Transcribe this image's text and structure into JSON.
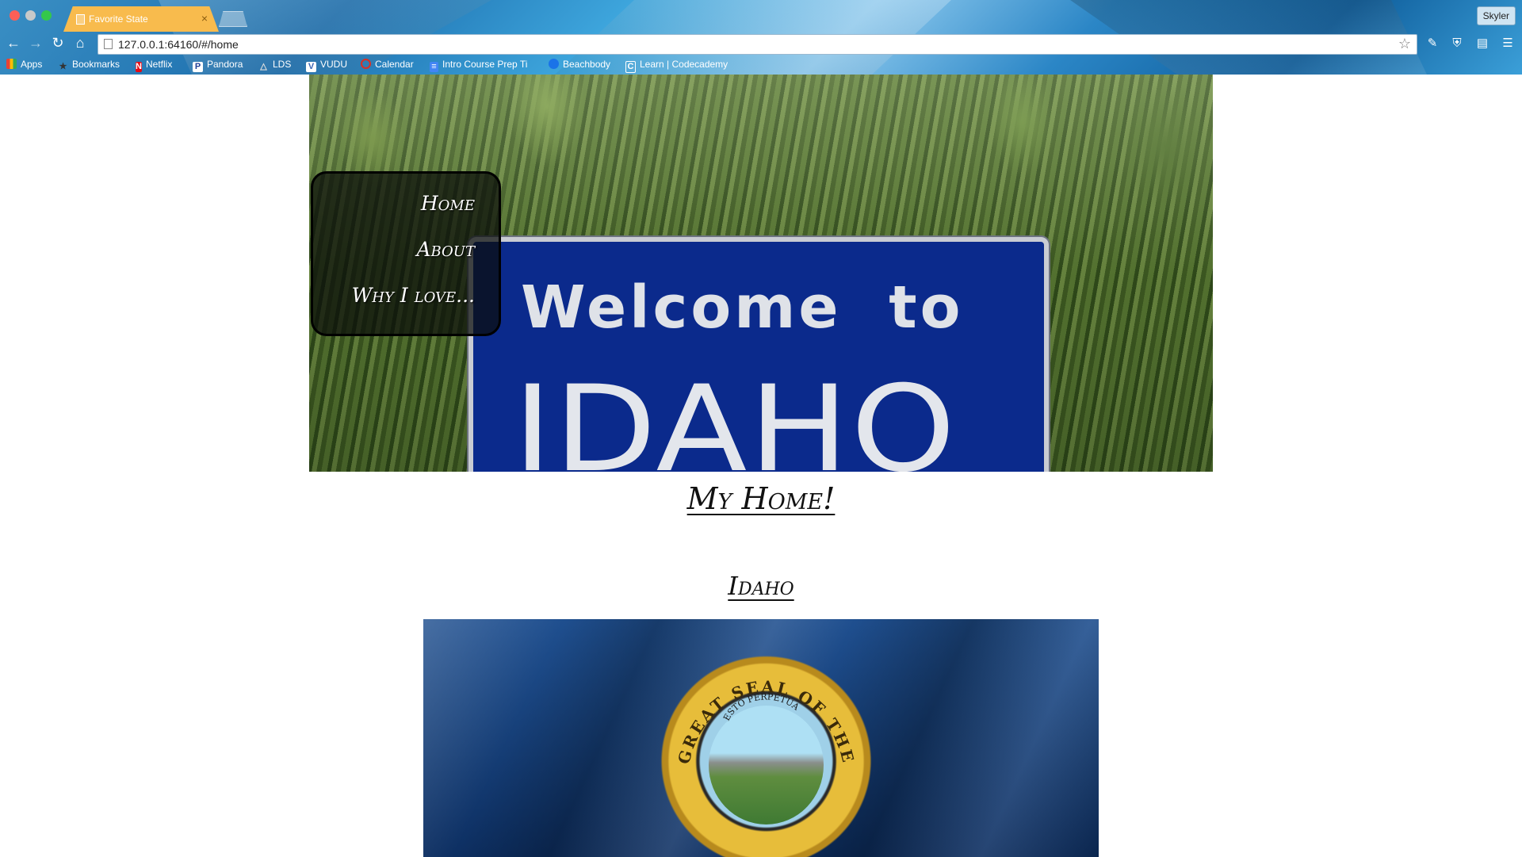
{
  "browser": {
    "tab_title": "Favorite State",
    "tab_close": "×",
    "profile_name": "Skyler",
    "url": "127.0.0.1:64160/#/home",
    "bookmarks": [
      {
        "label": "Apps",
        "icon": "apps-grid-icon",
        "color": "#e94235"
      },
      {
        "label": "Bookmarks",
        "icon": "star-icon",
        "color": "#444444"
      },
      {
        "label": "Netflix",
        "icon": "netflix-icon",
        "color": "#e50914"
      },
      {
        "label": "Pandora",
        "icon": "pandora-icon",
        "color": "#224099"
      },
      {
        "label": "LDS",
        "icon": "lds-icon",
        "color": "#7a7a7a"
      },
      {
        "label": "VUDU",
        "icon": "vudu-icon",
        "color": "#3b66b4"
      },
      {
        "label": "Calendar",
        "icon": "calendar-icon",
        "color": "#d93025"
      },
      {
        "label": "Intro Course Prep Ti",
        "icon": "document-icon",
        "color": "#4285f4"
      },
      {
        "label": "Beachbody",
        "icon": "beachbody-icon",
        "color": "#1a73e8"
      },
      {
        "label": "Learn | Codecademy",
        "icon": "codecademy-icon",
        "color": "#1f4056"
      }
    ]
  },
  "nav": {
    "home": "Home",
    "about": "About",
    "why": "Why I love..."
  },
  "hero": {
    "sign_line1": "Welcome to",
    "sign_line2": "IDAHO"
  },
  "main": {
    "heading": "My Home!",
    "state_name": "Idaho",
    "seal_text": "GREAT SEAL OF THE STATE OF IDAHO",
    "seal_motto": "ESTO PERPETUA"
  },
  "colors": {
    "flag_blue": "#163f78",
    "seal_gold": "#e7bd3a",
    "sign_blue": "#0b2a8c",
    "tab_orange": "#f8bb4d"
  }
}
